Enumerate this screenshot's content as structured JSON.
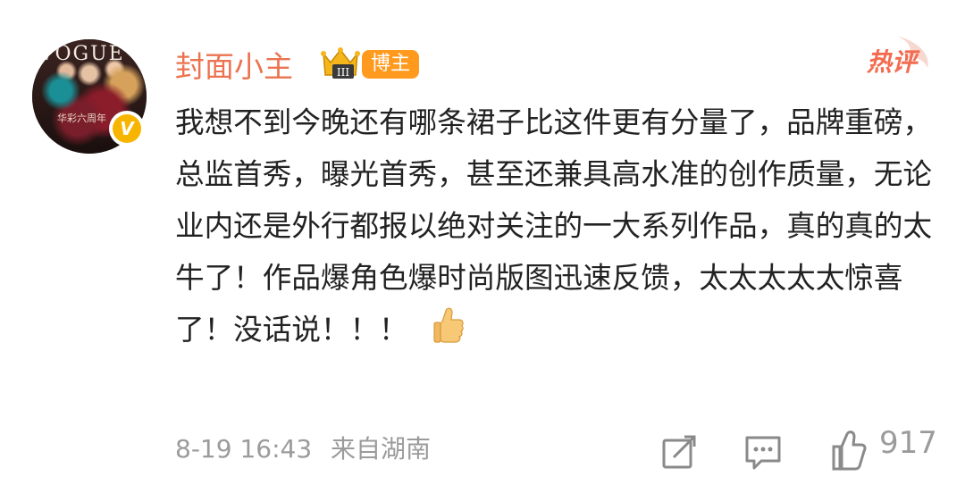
{
  "comment": {
    "username": "封面小主",
    "badge": "博主",
    "hot_label": "热评",
    "avatar_caption": "华彩六周年",
    "avatar_magazine": "VOGUE",
    "text": "我想不到今晚还有哪条裙子比这件更有分量了，品牌重磅，总监首秀，曝光首秀，甚至还兼具高水准的创作质量，无论业内还是外行都报以绝对关注的一大系列作品，真的真的太牛了！作品爆角色爆时尚版图迅速反馈，太太太太太惊喜了！没话说！！！",
    "emoji": "thumbs-up",
    "date": "8-19 16:43",
    "location": "来自湖南",
    "like_count": "917"
  },
  "colors": {
    "username": "#eb7350",
    "badge_bg": "#ff9a1e",
    "hot": "#f36b4f",
    "meta": "#9b9b9b",
    "text": "#222222"
  }
}
